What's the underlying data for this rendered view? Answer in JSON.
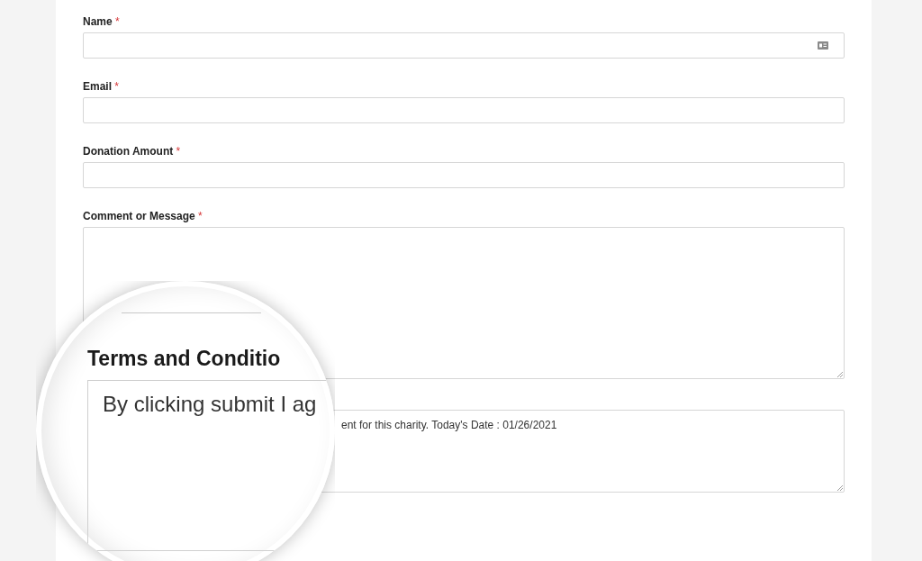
{
  "form": {
    "fields": [
      {
        "kind": "input",
        "label": "Name",
        "required_mark": "*",
        "autofill_icon": true
      },
      {
        "kind": "input",
        "label": "Email",
        "required_mark": "*"
      },
      {
        "kind": "input",
        "label": "Donation Amount",
        "required_mark": "*"
      },
      {
        "kind": "textarea",
        "label": "Comment or Message",
        "required_mark": "*"
      },
      {
        "kind": "textarea",
        "value": "ent for this charity. Today's Date : 01/26/2021"
      }
    ]
  },
  "magnifier": {
    "label": "Terms and Conditio",
    "value": "By clicking submit I ag"
  }
}
